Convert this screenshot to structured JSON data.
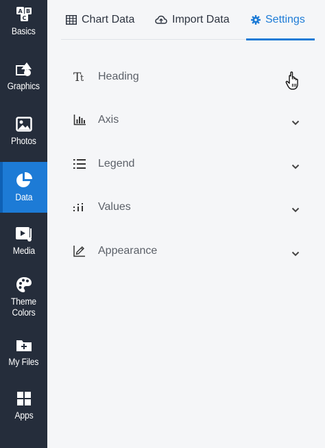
{
  "sidebar": {
    "items": [
      {
        "label": "Basics",
        "icon": "abc-blocks-icon"
      },
      {
        "label": "Graphics",
        "icon": "shapes-icon"
      },
      {
        "label": "Photos",
        "icon": "image-icon"
      },
      {
        "label": "Data",
        "icon": "pie-chart-icon",
        "active": true
      },
      {
        "label": "Media",
        "icon": "video-icon"
      },
      {
        "label": "Theme\nColors",
        "icon": "palette-icon"
      },
      {
        "label": "My Files",
        "icon": "folder-plus-icon"
      },
      {
        "label": "Apps",
        "icon": "apps-grid-icon"
      }
    ]
  },
  "tabs": [
    {
      "label": "Chart Data",
      "icon": "table-icon"
    },
    {
      "label": "Import Data",
      "icon": "cloud-upload-icon"
    },
    {
      "label": "Settings",
      "icon": "gear-icon",
      "active": true
    }
  ],
  "settings": [
    {
      "label": "Heading",
      "icon": "text-style-icon"
    },
    {
      "label": "Axis",
      "icon": "bar-chart-icon"
    },
    {
      "label": "Legend",
      "icon": "list-icon"
    },
    {
      "label": "Values",
      "icon": "values-icon"
    },
    {
      "label": "Appearance",
      "icon": "pencil-icon"
    }
  ],
  "colors": {
    "sidebar_bg": "#252d3b",
    "active_bg": "#1d7bd6",
    "accent": "#1d7bd6",
    "main_bg": "#f5f6f8"
  }
}
